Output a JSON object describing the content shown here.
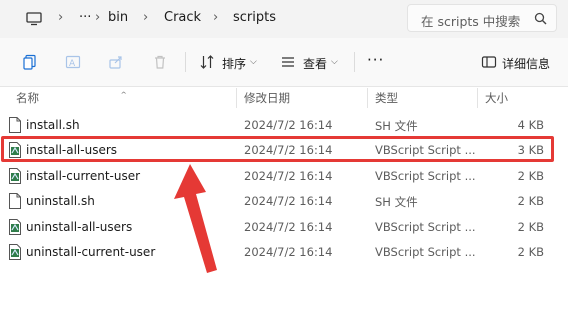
{
  "address": {
    "ellipsis": "···",
    "crumbs": [
      "bin",
      "Crack",
      "scripts"
    ],
    "search_placeholder": "在 scripts 中搜索"
  },
  "toolbar": {
    "sort_label": "排序",
    "view_label": "查看",
    "more_label": "···",
    "details_label": "详细信息"
  },
  "columns": {
    "name": "名称",
    "date": "修改日期",
    "type": "类型",
    "size": "大小"
  },
  "files": [
    {
      "name": "install.sh",
      "date": "2024/7/2 16:14",
      "type": "SH 文件",
      "size": "4 KB",
      "icon": "text-file-icon"
    },
    {
      "name": "install-all-users",
      "date": "2024/7/2 16:14",
      "type": "VBScript Script ...",
      "size": "3 KB",
      "icon": "vbscript-file-icon"
    },
    {
      "name": "install-current-user",
      "date": "2024/7/2 16:14",
      "type": "VBScript Script ...",
      "size": "2 KB",
      "icon": "vbscript-file-icon"
    },
    {
      "name": "uninstall.sh",
      "date": "2024/7/2 16:14",
      "type": "SH 文件",
      "size": "2 KB",
      "icon": "text-file-icon"
    },
    {
      "name": "uninstall-all-users",
      "date": "2024/7/2 16:14",
      "type": "VBScript Script ...",
      "size": "2 KB",
      "icon": "vbscript-file-icon"
    },
    {
      "name": "uninstall-current-user",
      "date": "2024/7/2 16:14",
      "type": "VBScript Script ...",
      "size": "2 KB",
      "icon": "vbscript-file-icon"
    }
  ],
  "annotation": {
    "color": "#e53935",
    "highlighted_file": "install-all-users"
  }
}
